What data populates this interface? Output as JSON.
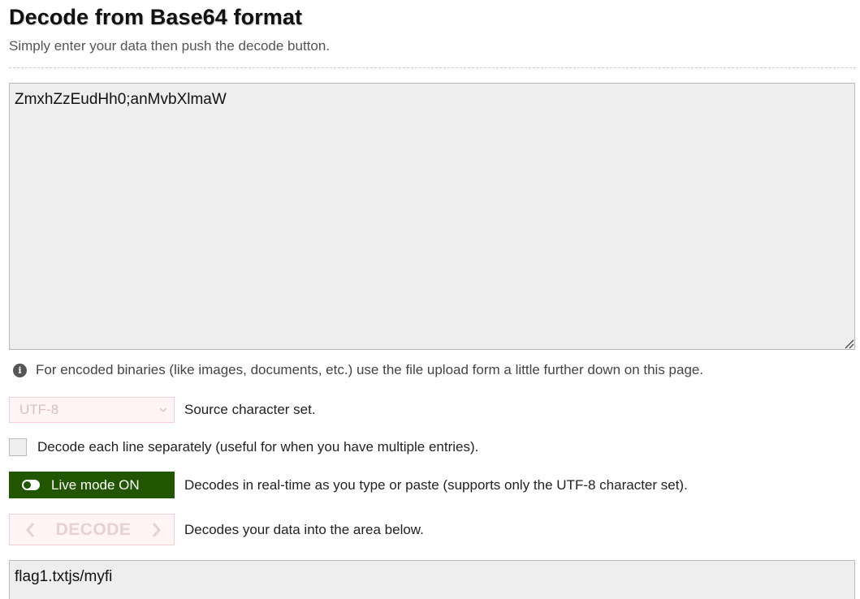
{
  "header": {
    "title": "Decode from Base64 format",
    "subtitle": "Simply enter your data then push the decode button."
  },
  "input": {
    "value": "ZmxhZzEudHh0;anMvbXlmaW"
  },
  "info": {
    "text": "For encoded binaries (like images, documents, etc.) use the file upload form a little further down on this page."
  },
  "charset": {
    "selected": "UTF-8",
    "description": "Source character set."
  },
  "line_separately": {
    "checked": false,
    "label": "Decode each line separately (useful for when you have multiple entries)."
  },
  "live_mode": {
    "label": "Live mode ON",
    "description": "Decodes in real-time as you type or paste (supports only the UTF-8 character set).",
    "color": "#225500"
  },
  "decode": {
    "label": "DECODE",
    "description": "Decodes your data into the area below."
  },
  "output": {
    "value": "flag1.txtjs/myfi"
  },
  "icons": {
    "info": "info-icon",
    "dropdown": "chevron-down-icon",
    "decode_left": "chevron-left-icon",
    "decode_right": "chevron-right-icon",
    "toggle": "toggle-on-icon",
    "resize": "resize-grip-icon"
  }
}
